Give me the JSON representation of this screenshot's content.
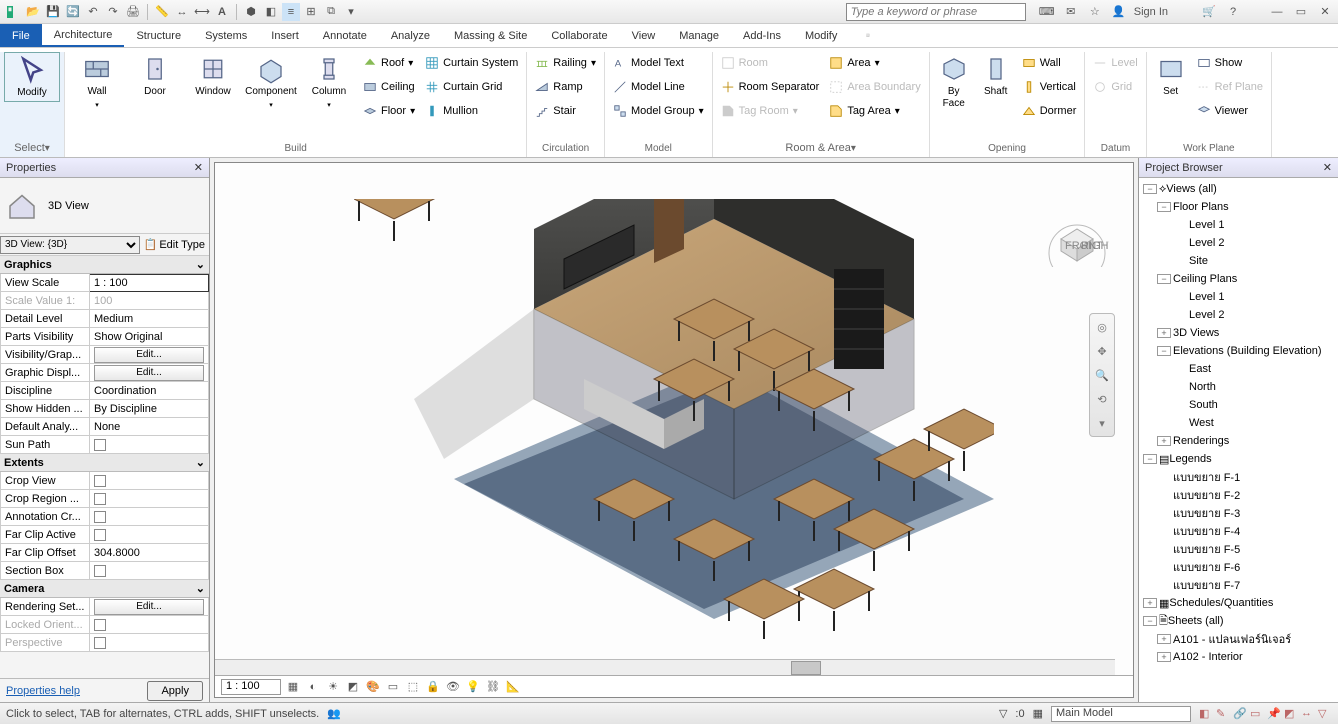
{
  "search_placeholder": "Type a keyword or phrase",
  "sign_in": "Sign In",
  "tabs": {
    "file": "File",
    "items": [
      "Architecture",
      "Structure",
      "Systems",
      "Insert",
      "Annotate",
      "Analyze",
      "Massing & Site",
      "Collaborate",
      "View",
      "Manage",
      "Add-Ins",
      "Modify"
    ]
  },
  "ribbon": {
    "select": {
      "modify": "Modify",
      "select": "Select",
      "label": "Select"
    },
    "build": {
      "wall": "Wall",
      "door": "Door",
      "window": "Window",
      "component": "Component",
      "column": "Column",
      "roof": "Roof",
      "ceiling": "Ceiling",
      "floor": "Floor",
      "curtain_system": "Curtain System",
      "curtain_grid": "Curtain Grid",
      "mullion": "Mullion",
      "label": "Build"
    },
    "circulation": {
      "railing": "Railing",
      "ramp": "Ramp",
      "stair": "Stair",
      "label": "Circulation"
    },
    "model": {
      "text": "Model Text",
      "line": "Model Line",
      "group": "Model Group",
      "label": "Model"
    },
    "room_area": {
      "room": "Room",
      "sep": "Room Separator",
      "tag_room": "Tag Room",
      "area": "Area",
      "area_bound": "Area Boundary",
      "tag_area": "Tag Area",
      "label": "Room & Area"
    },
    "opening": {
      "by_face": "By Face",
      "shaft": "Shaft",
      "wall": "Wall",
      "vertical": "Vertical",
      "dormer": "Dormer",
      "label": "Opening"
    },
    "datum": {
      "level": "Level",
      "grid": "Grid",
      "label": "Datum"
    },
    "workplane": {
      "set": "Set",
      "show": "Show",
      "ref": "Ref Plane",
      "viewer": "Viewer",
      "label": "Work Plane"
    }
  },
  "properties": {
    "title": "Properties",
    "type_name": "3D View",
    "selector": "3D View: {3D}",
    "edit_type": "Edit Type",
    "sections": {
      "graphics": "Graphics",
      "extents": "Extents",
      "camera": "Camera"
    },
    "graphics": {
      "view_scale_k": "View Scale",
      "view_scale_v": "1 : 100",
      "scale_value_k": "Scale Value   1:",
      "scale_value_v": "100",
      "detail_k": "Detail Level",
      "detail_v": "Medium",
      "parts_k": "Parts Visibility",
      "parts_v": "Show Original",
      "vg_k": "Visibility/Grap...",
      "vg_v": "Edit...",
      "gdisp_k": "Graphic Displ...",
      "gdisp_v": "Edit...",
      "disc_k": "Discipline",
      "disc_v": "Coordination",
      "hidden_k": "Show Hidden ...",
      "hidden_v": "By Discipline",
      "analy_k": "Default Analy...",
      "analy_v": "None",
      "sun_k": "Sun Path"
    },
    "extents": {
      "crop_k": "Crop View",
      "cropr_k": "Crop Region ...",
      "anno_k": "Annotation Cr...",
      "clip_k": "Far Clip Active",
      "clipo_k": "Far Clip Offset",
      "clipo_v": "304.8000",
      "sect_k": "Section Box"
    },
    "camera": {
      "render_k": "Rendering Set...",
      "render_v": "Edit...",
      "lock_k": "Locked Orient...",
      "persp_k": "Perspective"
    },
    "help": "Properties help",
    "apply": "Apply"
  },
  "viewport": {
    "scale": "1 : 100"
  },
  "browser": {
    "title": "Project Browser",
    "views": "Views (all)",
    "floor_plans": "Floor Plans",
    "fp": [
      "Level 1",
      "Level 2",
      "Site"
    ],
    "ceiling_plans": "Ceiling Plans",
    "cp": [
      "Level 1",
      "Level 2"
    ],
    "three_d": "3D Views",
    "elevations": "Elevations (Building Elevation)",
    "el": [
      "East",
      "North",
      "South",
      "West"
    ],
    "renderings": "Renderings",
    "legends": "Legends",
    "lg": [
      "แบบขยาย F-1",
      "แบบขยาย F-2",
      "แบบขยาย F-3",
      "แบบขยาย F-4",
      "แบบขยาย F-5",
      "แบบขยาย F-6",
      "แบบขยาย F-7"
    ],
    "schedules": "Schedules/Quantities",
    "sheets": "Sheets (all)",
    "sh": [
      "A101 - แปลนเฟอร์นิเจอร์",
      "A102 - Interior"
    ]
  },
  "status": {
    "hint": "Click to select, TAB for alternates, CTRL adds, SHIFT unselects.",
    "filter": ":0",
    "workset": "Main Model"
  }
}
